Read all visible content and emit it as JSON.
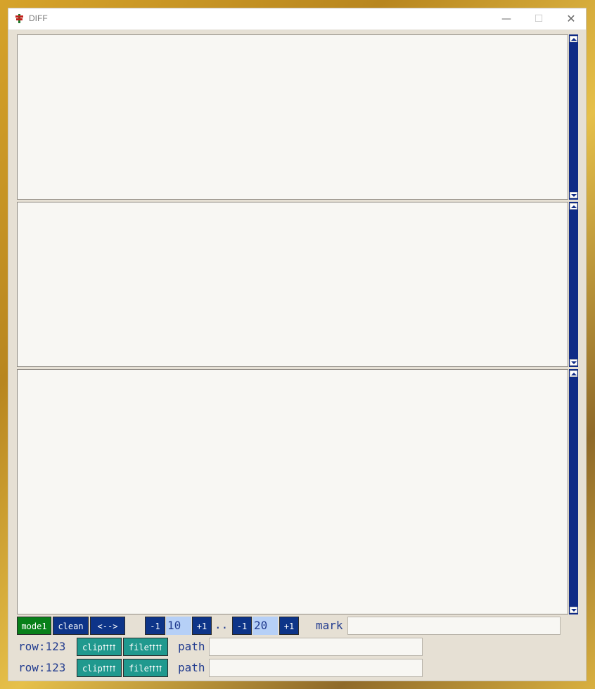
{
  "window": {
    "title": "DIFF",
    "controls": {
      "minimize": "—",
      "maximize": "☐",
      "close": "✕"
    }
  },
  "panes": [
    {
      "name": "diff-pane-1",
      "content": ""
    },
    {
      "name": "diff-pane-2",
      "content": ""
    },
    {
      "name": "diff-pane-3",
      "content": ""
    }
  ],
  "toolbar": {
    "mode_label": "mode1",
    "clean_label": "clean",
    "swap_label": "<-->",
    "range_start": {
      "minus_label": "-1",
      "value": "10",
      "plus_label": "+1"
    },
    "range_sep": "..",
    "range_end": {
      "minus_label": "-1",
      "value": "20",
      "plus_label": "+1"
    },
    "mark_label": "mark",
    "mark_value": ""
  },
  "rows": [
    {
      "row_label": "row:123",
      "clip_label": "clip⮅⮅",
      "file_label": "file⮅⮅",
      "path_label": "path",
      "path_value": ""
    },
    {
      "row_label": "row:123",
      "clip_label": "clip⮅⮅",
      "file_label": "file⮅⮅",
      "path_label": "path",
      "path_value": ""
    }
  ],
  "colors": {
    "accent_navy": "#0d3488",
    "accent_green": "#08801a",
    "accent_teal": "#20998e",
    "pane_bg": "#f8f7f3",
    "window_bg": "#e6e0d4"
  }
}
